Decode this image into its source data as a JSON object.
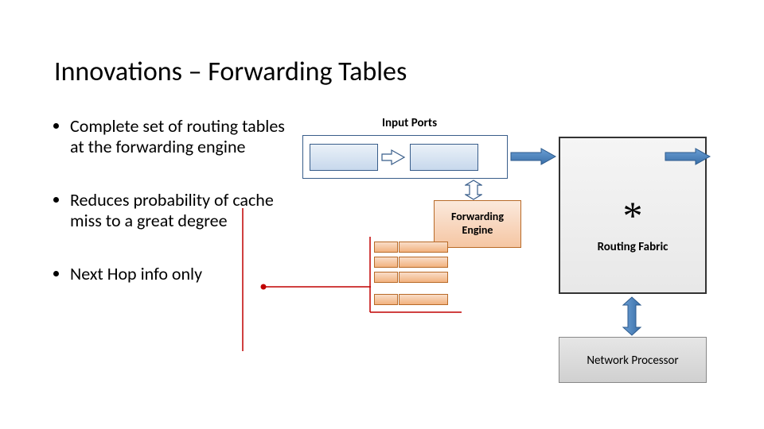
{
  "title": "Innovations – Forwarding Tables",
  "bullets": {
    "b1": "Complete set of routing tables at the forwarding engine",
    "b2": "Reduces probability of cache miss to a great degree",
    "b3": "Next Hop info only"
  },
  "diagram": {
    "input_ports": "Input Ports",
    "forwarding_engine_l1": "Forwarding",
    "forwarding_engine_l2": "Engine",
    "asterisk": "*",
    "routing_fabric": "Routing Fabric",
    "network_processor": "Network Processor"
  }
}
